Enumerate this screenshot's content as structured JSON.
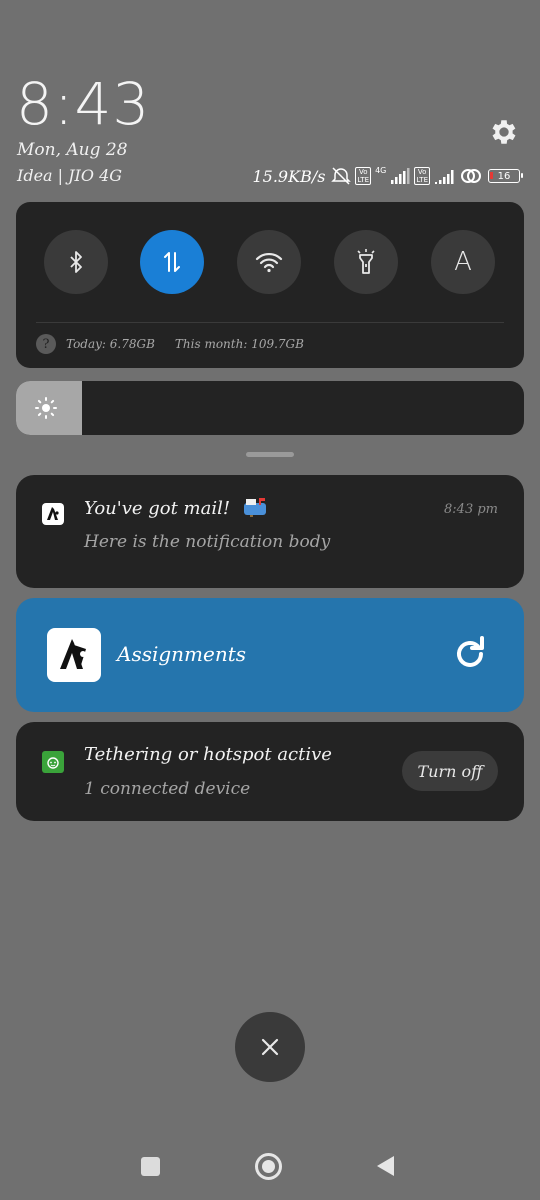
{
  "lockscreen": {
    "time": "8:43",
    "date": "Mon, Aug 28",
    "carrier": "Idea | JIO 4G"
  },
  "statusbar": {
    "speed": "15.9KB/s",
    "volte_badge": "Vo\nLTE",
    "network_type": "4G",
    "battery_level": "16",
    "icons": [
      "alarm-off-icon",
      "volte-icon",
      "signal-icon",
      "volte-icon",
      "signal-icon",
      "hotspot-icon",
      "battery-icon"
    ]
  },
  "quick_settings": {
    "toggles": [
      {
        "name": "bluetooth",
        "icon": "bluetooth-icon",
        "active": false
      },
      {
        "name": "mobile-data",
        "icon": "data-transfer-icon",
        "active": true
      },
      {
        "name": "wifi",
        "icon": "wifi-icon",
        "active": false
      },
      {
        "name": "flashlight",
        "icon": "flashlight-icon",
        "active": false
      },
      {
        "name": "auto-brightness",
        "icon": "letter-a-icon",
        "label": "A",
        "active": false
      }
    ],
    "usage_today": "Today: 6.78GB",
    "usage_month": "This month: 109.7GB",
    "brightness_level": 0.13
  },
  "notifications": [
    {
      "title": "You've got mail!",
      "time": "8:43 pm",
      "body": "Here is the notification body"
    },
    {
      "title": "Assignments"
    },
    {
      "title": "Tethering or hotspot active",
      "body": "1 connected device",
      "action": "Turn off"
    }
  ],
  "colors": {
    "background": "#707070",
    "panel": "#232323",
    "accent_blue": "#1a7fd6",
    "assignments_card": "#2575ad"
  }
}
